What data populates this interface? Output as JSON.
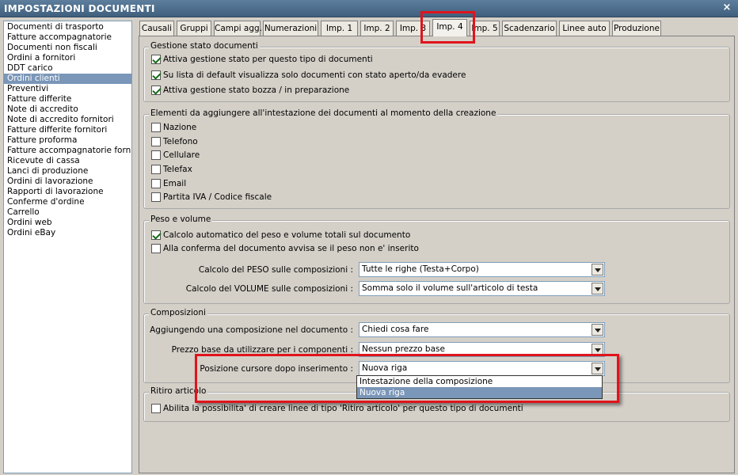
{
  "window": {
    "title": "IMPOSTAZIONI DOCUMENTI",
    "close_label": "×"
  },
  "document_types": [
    "Documenti di trasporto",
    "Fatture accompagnatorie",
    "Documenti non fiscali",
    "Ordini a fornitori",
    "DDT carico",
    "Ordini clienti",
    "Preventivi",
    "Fatture differite",
    "Note di accredito",
    "Note di accredito fornitori",
    "Fatture differite fornitori",
    "Fatture proforma",
    "Fatture accompagnatorie fornito",
    "Ricevute di cassa",
    "Lanci di produzione",
    "Ordini di lavorazione",
    "Rapporti di lavorazione",
    "Conferme d'ordine",
    "Carrello",
    "Ordini web",
    "Ordini eBay"
  ],
  "selected_document_type": "Ordini clienti",
  "tabs": [
    "Causali",
    "Gruppi",
    "Campi agg.",
    "Numerazioni",
    "Imp. 1",
    "Imp. 2",
    "Imp. 3",
    "Imp. 4",
    "Imp. 5",
    "Scadenzario",
    "Linee auto",
    "Produzione"
  ],
  "active_tab": "Imp. 4",
  "stato_documenti": {
    "title": "Gestione stato documenti",
    "items": [
      {
        "label": "Attiva gestione stato per questo tipo di documenti",
        "checked": true
      },
      {
        "label": "Su lista di default visualizza solo documenti con stato aperto/da evadere",
        "checked": true
      },
      {
        "label": "Attiva gestione stato bozza / in preparazione",
        "checked": true
      }
    ]
  },
  "intestazione": {
    "title": "Elementi da aggiungere all'intestazione dei documenti al momento della creazione",
    "items": [
      {
        "label": "Nazione",
        "checked": false
      },
      {
        "label": "Telefono",
        "checked": false
      },
      {
        "label": "Cellulare",
        "checked": false
      },
      {
        "label": "Telefax",
        "checked": false
      },
      {
        "label": "Email",
        "checked": false
      },
      {
        "label": "Partita IVA / Codice fiscale",
        "checked": false
      }
    ]
  },
  "peso_volume": {
    "title": "Peso e volume",
    "items": [
      {
        "label": "Calcolo automatico del peso e volume totali sul documento",
        "checked": true
      },
      {
        "label": "Alla conferma del documento avvisa se il peso non e' inserito",
        "checked": false
      }
    ],
    "peso_label": "Calcolo del PESO sulle composizioni :",
    "peso_value": "Tutte le righe (Testa+Corpo)",
    "volume_label": "Calcolo del VOLUME sulle composizioni :",
    "volume_value": "Somma solo il volume sull'articolo di testa"
  },
  "composizioni": {
    "title": "Composizioni",
    "aggiungendo_label": "Aggiungendo una composizione nel documento :",
    "aggiungendo_value": "Chiedi cosa fare",
    "prezzo_label": "Prezzo base da utilizzare per i componenti :",
    "prezzo_value": "Nessun prezzo base",
    "posizione_label": "Posizione cursore dopo inserimento :",
    "posizione_value": "Nuova riga",
    "posizione_options": [
      "Intestazione della composizione",
      "Nuova riga"
    ]
  },
  "ritiro": {
    "title": "Ritiro articolo",
    "item": {
      "label": "Abilita la possibilita' di creare linee di tipo 'Ritiro articolo' per questo tipo di documenti",
      "checked": false
    }
  },
  "colors": {
    "highlight": "#e0141c",
    "selection": "#7a96b8",
    "titlebar": "#4a6a8a"
  }
}
